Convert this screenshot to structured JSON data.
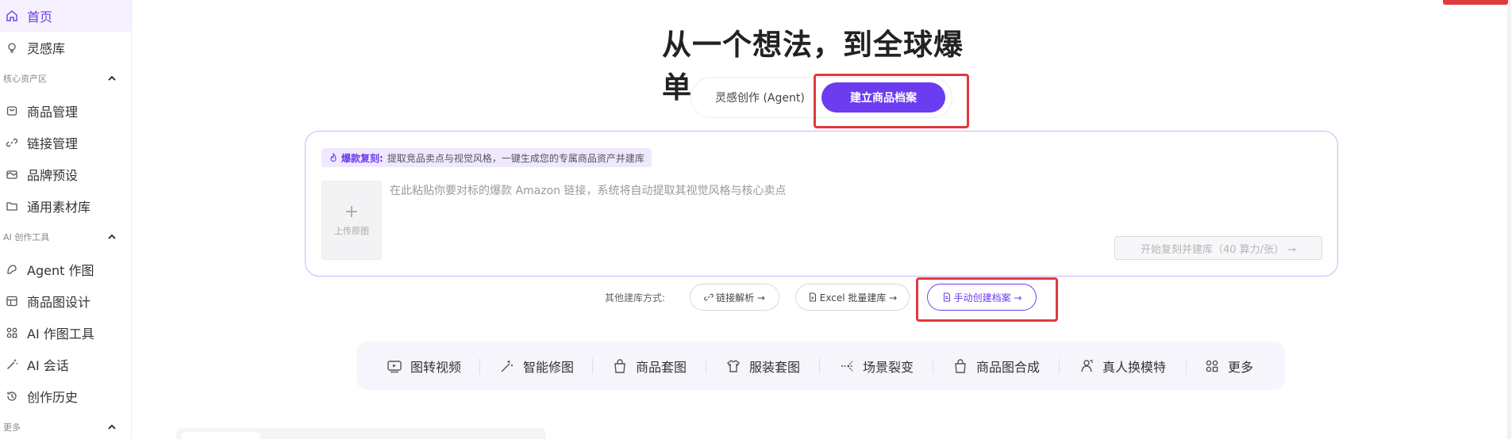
{
  "sidebar": {
    "items": [
      {
        "label": "首页",
        "icon": "home-icon"
      },
      {
        "label": "灵感库",
        "icon": "bulb-icon"
      },
      {
        "label": "商品管理",
        "icon": "box-icon"
      },
      {
        "label": "链接管理",
        "icon": "link-icon"
      },
      {
        "label": "品牌预设",
        "icon": "brand-icon"
      },
      {
        "label": "通用素材库",
        "icon": "folder-icon"
      },
      {
        "label": "Agent 作图",
        "icon": "agent-icon"
      },
      {
        "label": "商品图设计",
        "icon": "layout-icon"
      },
      {
        "label": "AI 作图工具",
        "icon": "grid-icon"
      },
      {
        "label": "AI 会话",
        "icon": "wand-icon"
      },
      {
        "label": "创作历史",
        "icon": "history-icon"
      }
    ],
    "sections": [
      {
        "label": "核心资产区"
      },
      {
        "label": "AI 创作工具"
      },
      {
        "label": "更多"
      }
    ]
  },
  "main": {
    "title": "从一个想法，到全球爆单",
    "tabs": [
      {
        "label": "灵感创作 (Agent)"
      },
      {
        "label": "建立商品档案"
      }
    ],
    "card": {
      "hint_tag": "爆款复刻:",
      "hint_text": "提取竞品卖点与视觉风格，一键生成您的专属商品资产并建库",
      "upload_label": "上传原图",
      "paste_placeholder": "在此粘贴你要对标的爆款 Amazon 链接，系统将自动提取其视觉风格与核心卖点",
      "start_button": "开始复刻并建库（40 算力/张） →"
    },
    "other_methods": {
      "label": "其他建库方式:",
      "buttons": [
        {
          "label": "链接解析 →"
        },
        {
          "label": "Excel 批量建库 →"
        },
        {
          "label": "手动创建档案 →"
        }
      ]
    },
    "tools": [
      {
        "label": "图转视频",
        "icon": "video-icon"
      },
      {
        "label": "智能修图",
        "icon": "retouch-icon"
      },
      {
        "label": "商品套图",
        "icon": "bag-icon"
      },
      {
        "label": "服装套图",
        "icon": "shirt-icon"
      },
      {
        "label": "场景裂变",
        "icon": "scene-icon"
      },
      {
        "label": "商品图合成",
        "icon": "bag-icon"
      },
      {
        "label": "真人换模特",
        "icon": "model-icon"
      },
      {
        "label": "更多",
        "icon": "grid-icon"
      }
    ]
  },
  "colors": {
    "accent": "#6c3cf0",
    "annotation_red": "#e0393e"
  }
}
